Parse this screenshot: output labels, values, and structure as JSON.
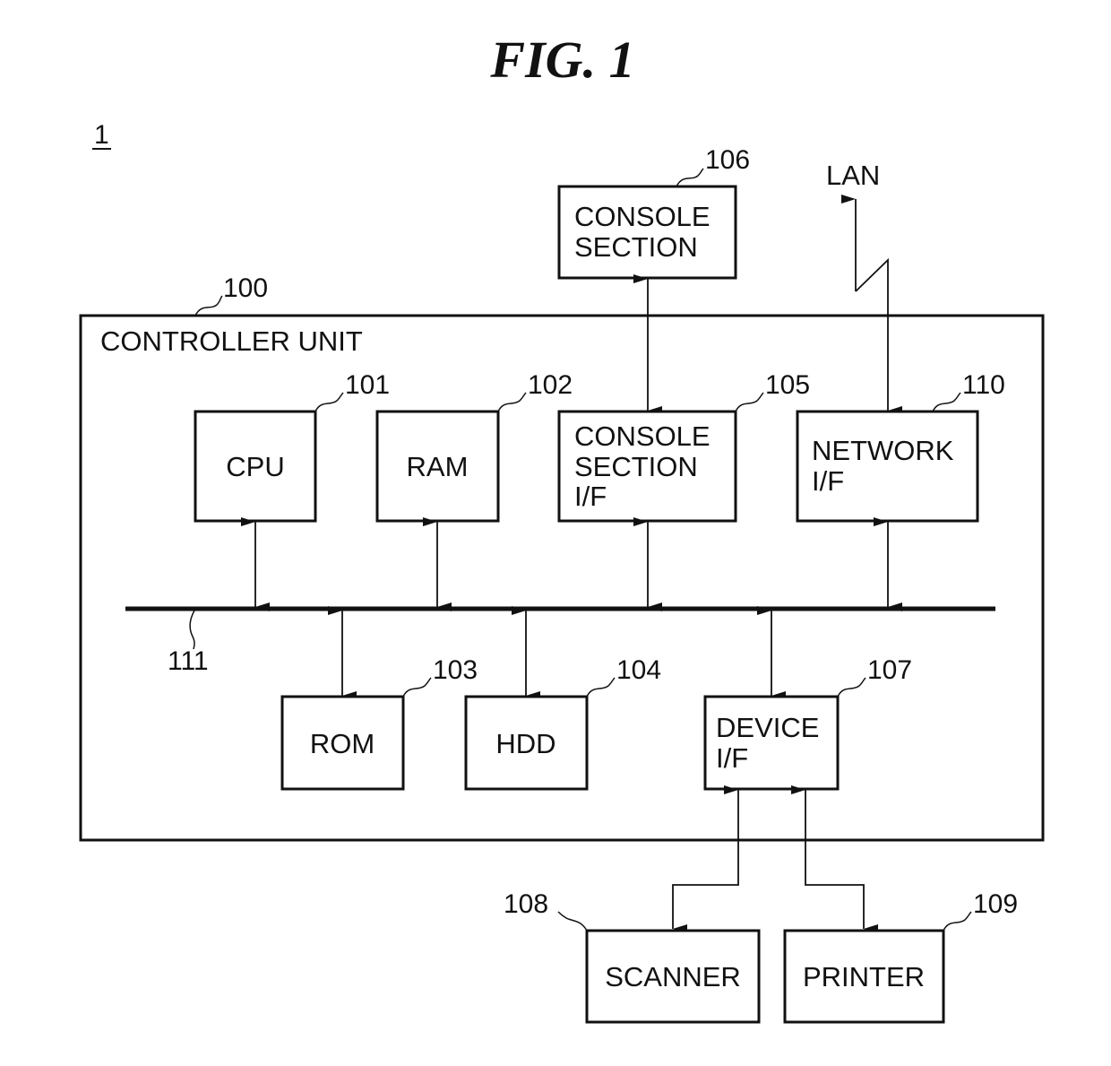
{
  "figure": {
    "title": "FIG. 1",
    "system_ref": "1"
  },
  "controller": {
    "label": "CONTROLLER UNIT",
    "ref": "100"
  },
  "bus": {
    "ref": "111"
  },
  "external": {
    "lan_label": "LAN"
  },
  "blocks": {
    "cpu": {
      "lines": [
        "CPU"
      ],
      "ref": "101"
    },
    "ram": {
      "lines": [
        "RAM"
      ],
      "ref": "102"
    },
    "rom": {
      "lines": [
        "ROM"
      ],
      "ref": "103"
    },
    "hdd": {
      "lines": [
        "HDD"
      ],
      "ref": "104"
    },
    "console_if": {
      "lines": [
        "CONSOLE",
        "SECTION",
        "I/F"
      ],
      "ref": "105"
    },
    "console": {
      "lines": [
        "CONSOLE",
        "SECTION"
      ],
      "ref": "106"
    },
    "device_if": {
      "lines": [
        "DEVICE",
        "I/F"
      ],
      "ref": "107"
    },
    "scanner": {
      "lines": [
        "SCANNER"
      ],
      "ref": "108"
    },
    "printer": {
      "lines": [
        "PRINTER"
      ],
      "ref": "109"
    },
    "network_if": {
      "lines": [
        "NETWORK",
        "I/F"
      ],
      "ref": "110"
    }
  }
}
